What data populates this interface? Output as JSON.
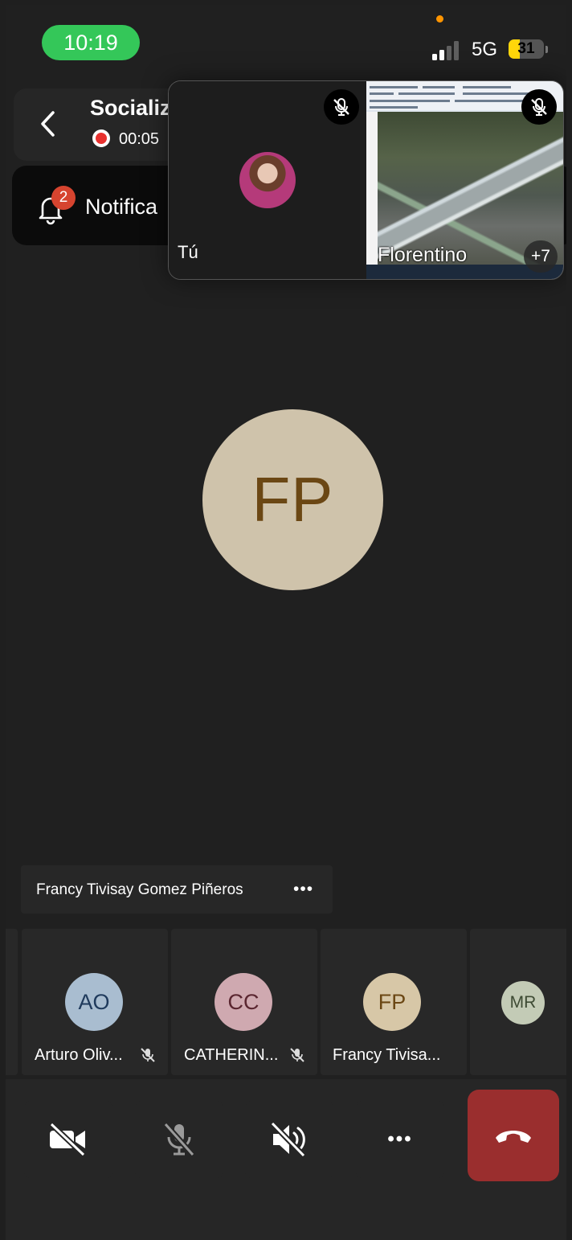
{
  "status_bar": {
    "time": "10:19",
    "network": "5G",
    "battery": "31",
    "battery_level": 0.31,
    "signal_bars": 2
  },
  "header": {
    "title": "Socializ",
    "recording_timer": "00:05"
  },
  "notification": {
    "label": "Notifica",
    "count": "2"
  },
  "floating_tiles": {
    "self_name": "Tú",
    "shared_name": "Florentino",
    "more_count": "+7"
  },
  "main": {
    "speaker_initials": "FP",
    "speaker_name": "Francy Tivisay Gomez Piñeros",
    "more_label": "•••"
  },
  "roster": [
    {
      "initials": "AO",
      "name": "Arturo Oliv...",
      "muted": true,
      "avatar_bg": "#a9bdd0",
      "avatar_fg": "#1f3a5c"
    },
    {
      "initials": "CC",
      "name": "CATHERIN...",
      "muted": true,
      "avatar_bg": "#cfa9b0",
      "avatar_fg": "#5a2630"
    },
    {
      "initials": "FP",
      "name": "Francy Tivisa...",
      "muted": false,
      "avatar_bg": "#d7c7a7",
      "avatar_fg": "#6b4714"
    },
    {
      "initials": "MR",
      "name": "",
      "muted": false,
      "avatar_bg": "#c3cbb6",
      "avatar_fg": "#3d4a33"
    }
  ],
  "controls": {
    "more_label": "•••"
  },
  "colors": {
    "accent_green": "#34c759",
    "hangup_red": "#9a2e2e",
    "notification_badge": "#d6442f",
    "recording_red": "#e8312f"
  },
  "icons": [
    "back-chevron-icon",
    "bell-icon",
    "mic-off-icon",
    "camera-off-icon",
    "speaker-off-icon",
    "more-icon",
    "hang-up-icon",
    "recording-icon"
  ]
}
